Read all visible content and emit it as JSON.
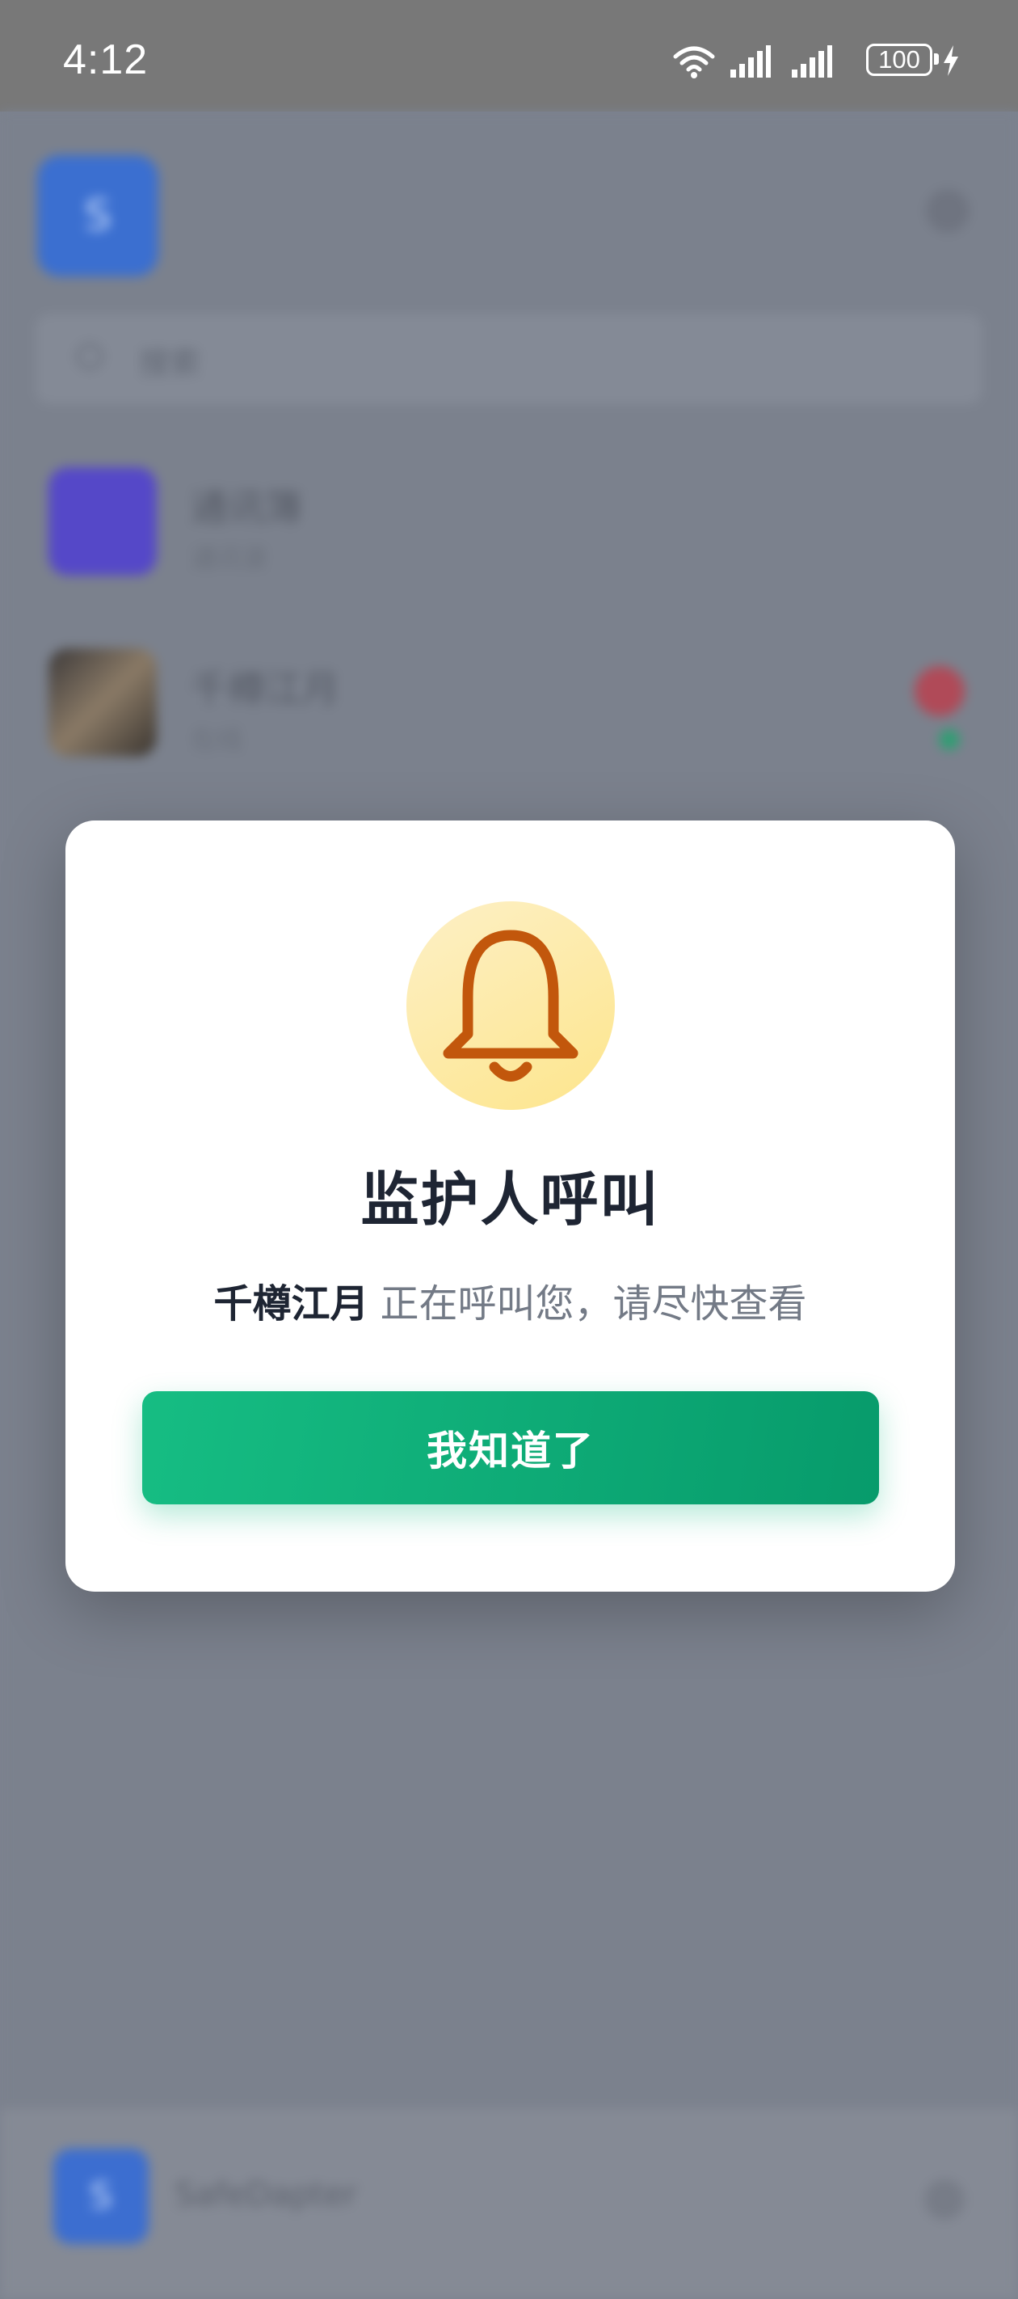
{
  "status_bar": {
    "time": "4:12",
    "battery": "100",
    "icons": [
      "wifi-icon",
      "signal-icon",
      "signal-icon",
      "battery-icon",
      "charging-icon"
    ]
  },
  "background": {
    "header_avatar_letter": "S",
    "search_placeholder": "搜索",
    "conversations": [
      {
        "name": "通讯簿",
        "subtitle": "通讯录",
        "avatar_color": "#5548c8"
      },
      {
        "name": "千樽江月",
        "subtitle": "在线",
        "avatar_color": "#4d4540"
      }
    ],
    "footer_avatar_letter": "S",
    "footer_text": "SafeDapter"
  },
  "dialog": {
    "icon": "bell-icon",
    "title": "监护人呼叫",
    "caller_name": "千樽江月",
    "message": "正在呼叫您，请尽快查看",
    "confirm_label": "我知道了"
  },
  "colors": {
    "accent": "#10b981",
    "accent_dark": "#059669",
    "bell_stroke": "#c2570c",
    "bell_bg": "#fdecad",
    "title": "#1e2533",
    "muted": "#737a86"
  }
}
